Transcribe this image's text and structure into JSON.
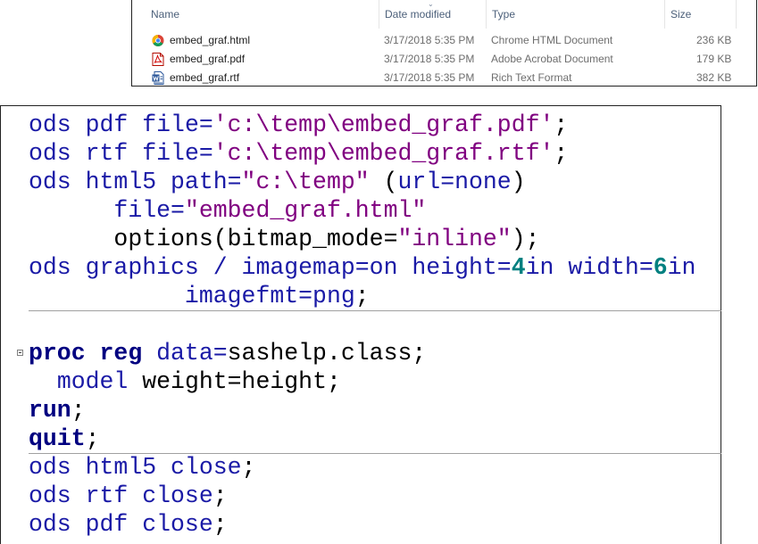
{
  "explorer": {
    "columns": {
      "name": "Name",
      "date": "Date modified",
      "type": "Type",
      "size": "Size"
    },
    "files": [
      {
        "name": "embed_graf.html",
        "date": "3/17/2018 5:35 PM",
        "type": "Chrome HTML Document",
        "size": "236 KB",
        "icon": "chrome-icon"
      },
      {
        "name": "embed_graf.pdf",
        "date": "3/17/2018 5:35 PM",
        "type": "Adobe Acrobat Document",
        "size": "179 KB",
        "icon": "pdf-icon"
      },
      {
        "name": "embed_graf.rtf",
        "date": "3/17/2018 5:35 PM",
        "type": "Rich Text Format",
        "size": "382 KB",
        "icon": "word-icon"
      }
    ]
  },
  "code": {
    "lines": [
      [
        {
          "t": "ods pdf ",
          "c": "kw"
        },
        {
          "t": "file=",
          "c": "kw"
        },
        {
          "t": "'c:\\temp\\embed_graf.pdf'",
          "c": "str"
        },
        {
          "t": ";",
          "c": "plain"
        }
      ],
      [
        {
          "t": "ods rtf ",
          "c": "kw"
        },
        {
          "t": "file=",
          "c": "kw"
        },
        {
          "t": "'c:\\temp\\embed_graf.rtf'",
          "c": "str"
        },
        {
          "t": ";",
          "c": "plain"
        }
      ],
      [
        {
          "t": "ods html5 ",
          "c": "kw"
        },
        {
          "t": "path=",
          "c": "kw"
        },
        {
          "t": "\"c:\\temp\"",
          "c": "str"
        },
        {
          "t": " (",
          "c": "plain"
        },
        {
          "t": "url=none",
          "c": "kw"
        },
        {
          "t": ")",
          "c": "plain"
        }
      ],
      [
        {
          "t": "      ",
          "c": "plain"
        },
        {
          "t": "file=",
          "c": "kw"
        },
        {
          "t": "\"embed_graf.html\"",
          "c": "str"
        }
      ],
      [
        {
          "t": "      options(bitmap_mode=",
          "c": "plain"
        },
        {
          "t": "\"inline\"",
          "c": "str"
        },
        {
          "t": ");",
          "c": "plain"
        }
      ],
      [
        {
          "t": "ods graphics / ",
          "c": "kw"
        },
        {
          "t": "imagemap=on height=",
          "c": "kw"
        },
        {
          "t": "4",
          "c": "num"
        },
        {
          "t": "in width=",
          "c": "kw"
        },
        {
          "t": "6",
          "c": "num"
        },
        {
          "t": "in",
          "c": "kw"
        }
      ],
      [
        {
          "t": "           imagefmt=png",
          "c": "kw"
        },
        {
          "t": ";",
          "c": "plain"
        }
      ],
      [],
      [
        {
          "t": "proc reg ",
          "c": "bold"
        },
        {
          "t": "data=",
          "c": "kw"
        },
        {
          "t": "sashelp.class;",
          "c": "plain"
        }
      ],
      [
        {
          "t": "  ",
          "c": "plain"
        },
        {
          "t": "model ",
          "c": "kw"
        },
        {
          "t": "weight=height;",
          "c": "plain"
        }
      ],
      [
        {
          "t": "run",
          "c": "bold"
        },
        {
          "t": ";",
          "c": "plain"
        }
      ],
      [
        {
          "t": "quit",
          "c": "bold"
        },
        {
          "t": ";",
          "c": "plain"
        }
      ],
      [
        {
          "t": "ods html5 close",
          "c": "kw"
        },
        {
          "t": ";",
          "c": "plain"
        }
      ],
      [
        {
          "t": "ods rtf close",
          "c": "kw"
        },
        {
          "t": ";",
          "c": "plain"
        }
      ],
      [
        {
          "t": "ods pdf close",
          "c": "kw"
        },
        {
          "t": ";",
          "c": "plain"
        }
      ]
    ]
  }
}
